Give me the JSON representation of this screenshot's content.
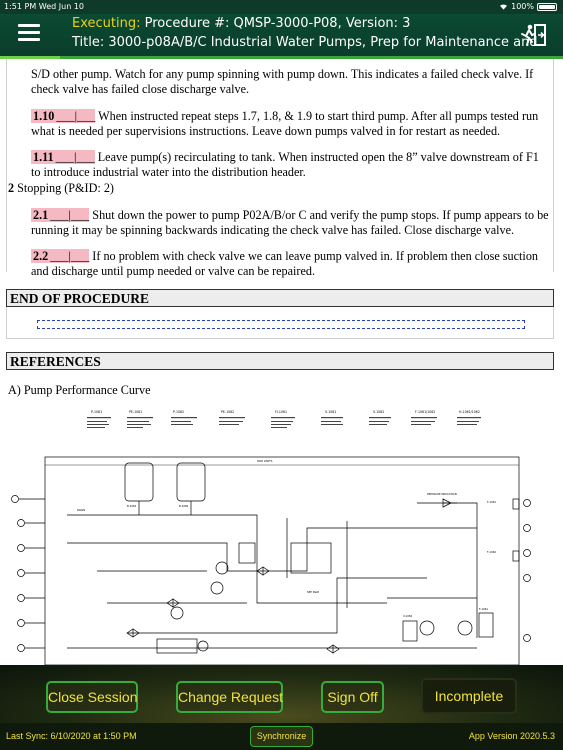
{
  "status_bar": {
    "time": "1:51 PM",
    "date": "Wed Jun 10",
    "battery": "100%"
  },
  "header": {
    "executing_label": "Executing:",
    "procedure_info": "Procedure #: QMSP-3000-P08,  Version: 3",
    "title": "Title: 3000-p08A/B/C Industrial Water Pumps,  Prep for Maintenance and"
  },
  "document": {
    "intro_text": "S/D other pump. Watch for any pump spinning with pump down. This indicates a failed check valve. If check valve has failed close discharge valve.",
    "steps_section1": [
      {
        "num": "1.10",
        "blank": "___|___",
        "text": " When instructed repeat steps 1.7, 1.8, & 1.9 to start third pump. After all pumps tested run what is needed per supervisions instructions. Leave down pumps valved in for restart as needed."
      },
      {
        "num": "1.11",
        "blank": "___|___",
        "text": " Leave pump(s) recirculating to tank. When instructed open the 8” valve downstream of F1 to introduce industrial water into the distribution header."
      }
    ],
    "section2": {
      "num": "2",
      "title": "Stopping (P&ID: 2)"
    },
    "steps_section2": [
      {
        "num": "2.1",
        "blank": "___|___",
        "text": " Shut down the power to pump P02A/B/or C and verify the pump stops. If pump appears to be running it may be spinning backwards indicating the check valve has failed. Close discharge valve."
      },
      {
        "num": "2.2",
        "blank": "___|___",
        "text": " If no problem with check valve we can leave pump valved in. If problem then close suction and discharge until pump needed or valve can be repaired."
      }
    ],
    "end_heading": "END OF PROCEDURE",
    "references_heading": "REFERENCES",
    "ref_a": "A) Pump Performance Curve"
  },
  "footer": {
    "buttons": {
      "close_session": "Close Session",
      "change_request": "Change Request",
      "sign_off": "Sign Off",
      "incomplete": "Incomplete"
    },
    "last_sync": "Last Sync: 6/10/2020 at 1:50 PM",
    "synchronize": "Synchronize",
    "app_version": "App Version 2020.5.3"
  },
  "colors": {
    "header_bg": "#0b4a33",
    "executing_accent": "#e9d21a",
    "button_text": "#f2e23a",
    "button_border": "#36ad3a",
    "step_highlight": "#f4b9c3"
  }
}
